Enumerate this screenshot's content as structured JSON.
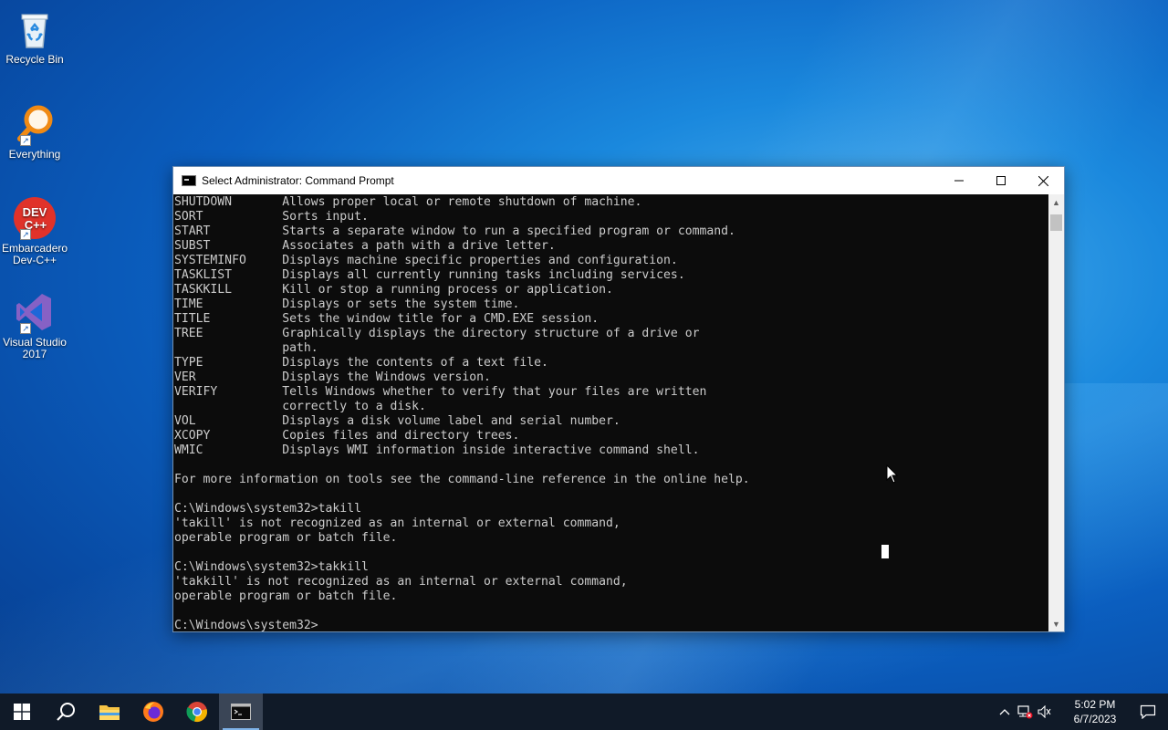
{
  "desktop": {
    "icons": [
      {
        "label": "Recycle Bin",
        "icon": "recycle-bin-icon"
      },
      {
        "label": "Everything",
        "icon": "everything-search-icon"
      },
      {
        "label": "Embarcadero Dev-C++",
        "icon": "devcpp-icon",
        "logo_text": "DEV C++"
      },
      {
        "label": "Visual Studio 2017",
        "icon": "visual-studio-icon"
      }
    ]
  },
  "window": {
    "title": "Select Administrator:  Command Prompt",
    "buttons": {
      "minimize": "—",
      "maximize": "☐",
      "close": "✕"
    },
    "console_lines": [
      "SHUTDOWN       Allows proper local or remote shutdown of machine.",
      "SORT           Sorts input.",
      "START          Starts a separate window to run a specified program or command.",
      "SUBST          Associates a path with a drive letter.",
      "SYSTEMINFO     Displays machine specific properties and configuration.",
      "TASKLIST       Displays all currently running tasks including services.",
      "TASKKILL       Kill or stop a running process or application.",
      "TIME           Displays or sets the system time.",
      "TITLE          Sets the window title for a CMD.EXE session.",
      "TREE           Graphically displays the directory structure of a drive or",
      "               path.",
      "TYPE           Displays the contents of a text file.",
      "VER            Displays the Windows version.",
      "VERIFY         Tells Windows whether to verify that your files are written",
      "               correctly to a disk.",
      "VOL            Displays a disk volume label and serial number.",
      "XCOPY          Copies files and directory trees.",
      "WMIC           Displays WMI information inside interactive command shell.",
      "",
      "For more information on tools see the command-line reference in the online help.",
      "",
      "C:\\Windows\\system32>takill",
      "'takill' is not recognized as an internal or external command,",
      "operable program or batch file.",
      "",
      "C:\\Windows\\system32>takkill",
      "'takkill' is not recognized as an internal or external command,",
      "operable program or batch file.",
      "",
      "C:\\Windows\\system32>"
    ]
  },
  "taskbar": {
    "apps": [
      "start-icon",
      "search-icon",
      "file-explorer-icon",
      "firefox-icon",
      "chrome-icon",
      "command-prompt-icon"
    ],
    "tray": {
      "chevron": "^",
      "time": "5:02 PM",
      "date": "6/7/2023"
    }
  },
  "colors": {
    "console_bg": "#0c0c0c",
    "console_fg": "#cccccc",
    "taskbar_bg": "#101a28"
  }
}
